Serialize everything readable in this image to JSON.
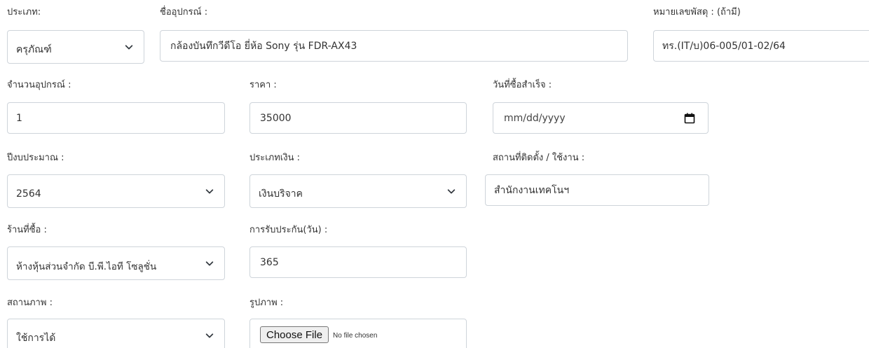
{
  "fields": {
    "type": {
      "label": "ประเภท:",
      "value": "ครุภัณฑ์"
    },
    "device_name": {
      "label": "ชื่ออุปกรณ์ :",
      "value": "กล้องบันทึกวีดีโอ ยี่ห้อ Sony รุ่น FDR-AX43"
    },
    "parcel_number": {
      "label": "หมายเลขพัสดุ : (ถ้ามี)",
      "value": "ทร.(IT/บ)06-005/01-02/64"
    },
    "quantity": {
      "label": "จำนวนอุปกรณ์ :",
      "value": "1"
    },
    "price": {
      "label": "ราคา :",
      "value": "35000"
    },
    "purchase_date": {
      "label": "วันที่ซื้อสำเร็จ :",
      "placeholder": "mm/dd/yyyy"
    },
    "budget_year": {
      "label": "ปีงบประมาณ :",
      "value": "2564"
    },
    "money_type": {
      "label": "ประเภทเงิน :",
      "value": "เงินบริจาค"
    },
    "location": {
      "label": "สถานที่ติดตั้ง / ใช้งาน :",
      "value": "สำนักงานเทคโนฯ"
    },
    "store": {
      "label": "ร้านที่ซื้อ :",
      "value": "ห้างหุ้นส่วนจำกัด บี.พี.ไอที โซลูชั่น"
    },
    "warranty": {
      "label": "การรับประกัน(วัน) :",
      "value": "365"
    },
    "status": {
      "label": "สถานภาพ :",
      "value": "ใช้การได้"
    },
    "image": {
      "label": "รูปภาพ :",
      "button_label": "Choose File",
      "status_text": "No file chosen"
    }
  },
  "icons": {
    "select_arrow": "chevron-down-icon",
    "date_picker": "calendar-icon"
  },
  "colors": {
    "border": "#ced4da",
    "label_text": "#333333",
    "file_button_bg": "#efefef"
  }
}
